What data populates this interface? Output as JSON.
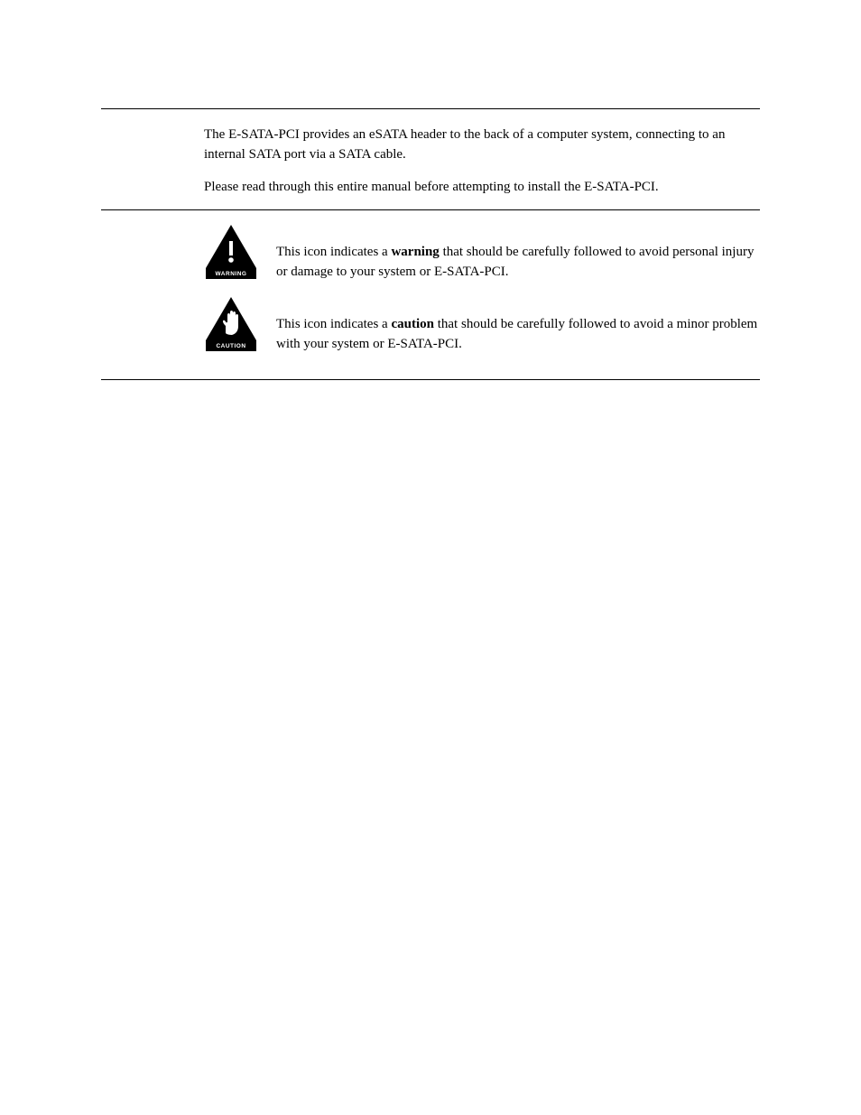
{
  "intro": {
    "p1": "The E-SATA-PCI provides an eSATA header to the back of a computer system, connecting to an internal SATA port via a SATA cable.",
    "p2": "Please read through this entire manual before attempting to install the E-SATA-PCI."
  },
  "legend": {
    "warning_label": "WARNING",
    "caution_label": "CAUTION",
    "warning_text_prefix": "This icon indicates a ",
    "warning_text_strong": "warning",
    "warning_text_suffix": " that should be carefully followed to avoid personal injury or damage to your system or E-SATA-PCI.",
    "caution_text_prefix": "This icon indicates a ",
    "caution_text_strong": "caution",
    "caution_text_suffix": " that should be carefully followed to avoid a minor problem with your system or E-SATA-PCI."
  }
}
